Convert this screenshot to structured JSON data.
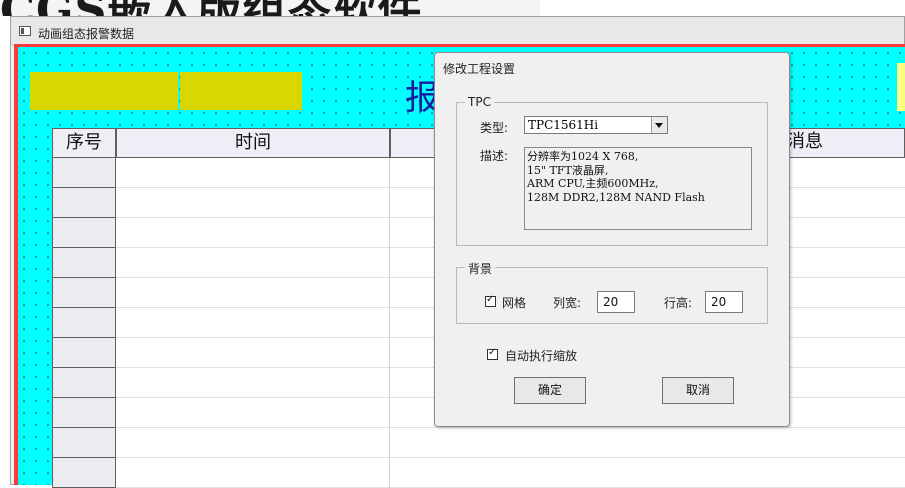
{
  "banner": {
    "text": "CGS嵌入版组态软件"
  },
  "window": {
    "title": "动画组态报警数据"
  },
  "canvas": {
    "title": "报警数据"
  },
  "table": {
    "headers": [
      "序号",
      "时间",
      "",
      "消息"
    ]
  },
  "dialog": {
    "title": "修改工程设置",
    "tpc_group": "TPC",
    "type_label": "类型:",
    "type_value": "TPC1561Hi",
    "desc_label": "描述:",
    "desc_lines": [
      "分辨率为1024 X 768,",
      "15\" TFT液晶屏,",
      "ARM CPU,主频600MHz,",
      "128M DDR2,128M NAND Flash"
    ],
    "bg_group": "背景",
    "grid_label": "网格",
    "grid_checked": true,
    "col_width_label": "列宽:",
    "col_width_value": "20",
    "row_height_label": "行高:",
    "row_height_value": "20",
    "auto_scale_label": "自动执行缩放",
    "auto_scale_checked": true,
    "ok_label": "确定",
    "cancel_label": "取消"
  },
  "colors": {
    "canvas": "#00ffff",
    "canvas_edge": "#ff3a3a",
    "yellow": "#d8d800",
    "title_blue": "#1a1aa0"
  }
}
